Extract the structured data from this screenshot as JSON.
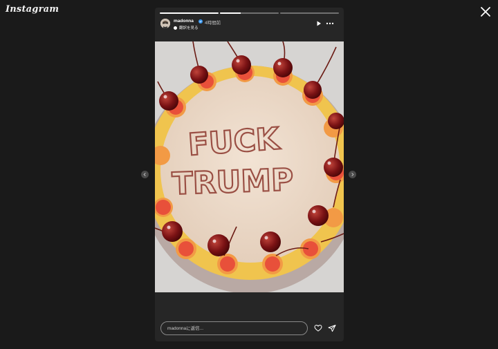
{
  "app": {
    "logo_text": "Instagram"
  },
  "story": {
    "progress": [
      1.0,
      0.35,
      0.0
    ],
    "user": {
      "username": "madonna",
      "verified": true,
      "time_ago": "4時間前"
    },
    "translate_label": "翻訳を見る",
    "image": {
      "cake_text_line1": "FUCK",
      "cake_text_line2": "TRUMP"
    }
  },
  "reply": {
    "placeholder": "madonnaに返信..."
  },
  "icons": {
    "close": "close-icon",
    "prev": "chevron-left-icon",
    "next": "chevron-right-icon",
    "play": "play-icon",
    "more": "more-icon",
    "like": "heart-icon",
    "share": "send-icon"
  },
  "colors": {
    "background": "#1a1a1a",
    "story_bg": "#262626",
    "frosting_text": "#8a4a40"
  }
}
